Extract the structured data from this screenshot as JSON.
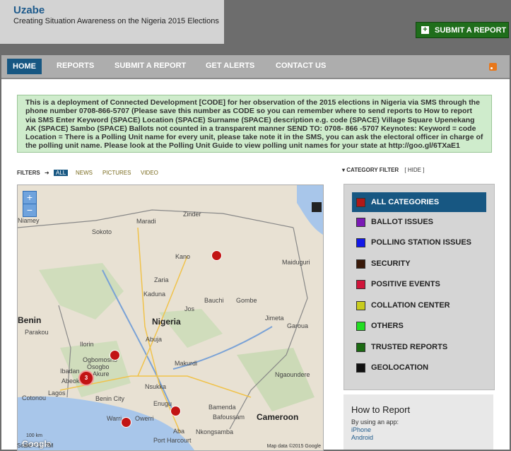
{
  "brand": {
    "title": "Uzabe",
    "tagline": "Creating Situation Awareness on the Nigeria 2015 Elections"
  },
  "submit_button": "SUBMIT A REPORT",
  "nav": [
    "HOME",
    "REPORTS",
    "SUBMIT A REPORT",
    "GET ALERTS",
    "CONTACT US"
  ],
  "notice": "This is a deployment of Connected Development [CODE] for her observation of the 2015 elections in Nigeria via SMS through the phone number 0708-866-5707 (Please save this number as CODE so you can remember where to send reports to How to report via SMS Enter Keyword (SPACE) Location (SPACE) Surname (SPACE) description e.g. code (SPACE) Village Square Upenekang AK (SPACE) Sambo (SPACE) Ballots not counted in a transparent manner SEND TO: 0708- 866 -5707 Keynotes: Keyword = code Location = There is a Polling Unit name for every unit, please take note it in the SMS, you can ask the electoral officer in charge of the polling unit name. Please look at the Polling Unit Guide to view polling unit names for your state at http://goo.gl/6TXaE1",
  "filters": {
    "label": "FILTERS",
    "arrow": "➜",
    "items": [
      "ALL",
      "NEWS",
      "PICTURES",
      "VIDEO"
    ]
  },
  "category_filter": {
    "label": "CATEGORY FILTER",
    "hide": "[ HIDE ]"
  },
  "categories": [
    {
      "label": "ALL CATEGORIES",
      "color": "#b01818"
    },
    {
      "label": "BALLOT ISSUES",
      "color": "#7a1ab5"
    },
    {
      "label": "POLLING STATION ISSUES",
      "color": "#1218e8"
    },
    {
      "label": "SECURITY",
      "color": "#3a1a0a"
    },
    {
      "label": "POSITIVE EVENTS",
      "color": "#d0143a"
    },
    {
      "label": "COLLATION CENTER",
      "color": "#c8cc1e"
    },
    {
      "label": "OTHERS",
      "color": "#22dd22"
    },
    {
      "label": "TRUSTED REPORTS",
      "color": "#1b6a12"
    },
    {
      "label": "GEOLOCATION",
      "color": "#111111"
    }
  ],
  "map": {
    "zoom_in": "+",
    "zoom_out": "−",
    "countries": [
      "Benin",
      "Nigeria",
      "Cameroon"
    ],
    "places": [
      "Niamey",
      "Maradi",
      "Zinder",
      "Sokoto",
      "Kano",
      "Maiduguri",
      "Zaria",
      "Kaduna",
      "Bauchi",
      "Gombe",
      "Jos",
      "Parakou",
      "Abuja",
      "Jimeta",
      "Garoua",
      "Ilorin",
      "Ogbomosho",
      "Osogbo",
      "Ibadan",
      "Akure",
      "Makurdi",
      "Abeokuta",
      "Lagos",
      "Cotonou",
      "Nsukka",
      "Enugu",
      "Benin City",
      "Ngaoundere",
      "Warri",
      "Owerri",
      "Bamenda",
      "Bafoussam",
      "Port Harcourt",
      "Aba",
      "Nkongsamba"
    ],
    "cluster_count": "3",
    "credit": "Map data ©2015 Google",
    "scale_km": "100 km",
    "google": "Google",
    "scale_text": "Scale = 1 : 7M"
  },
  "howto": {
    "title": "How to Report",
    "subtitle": "By using an app:",
    "links": [
      "iPhone",
      "Android"
    ]
  }
}
